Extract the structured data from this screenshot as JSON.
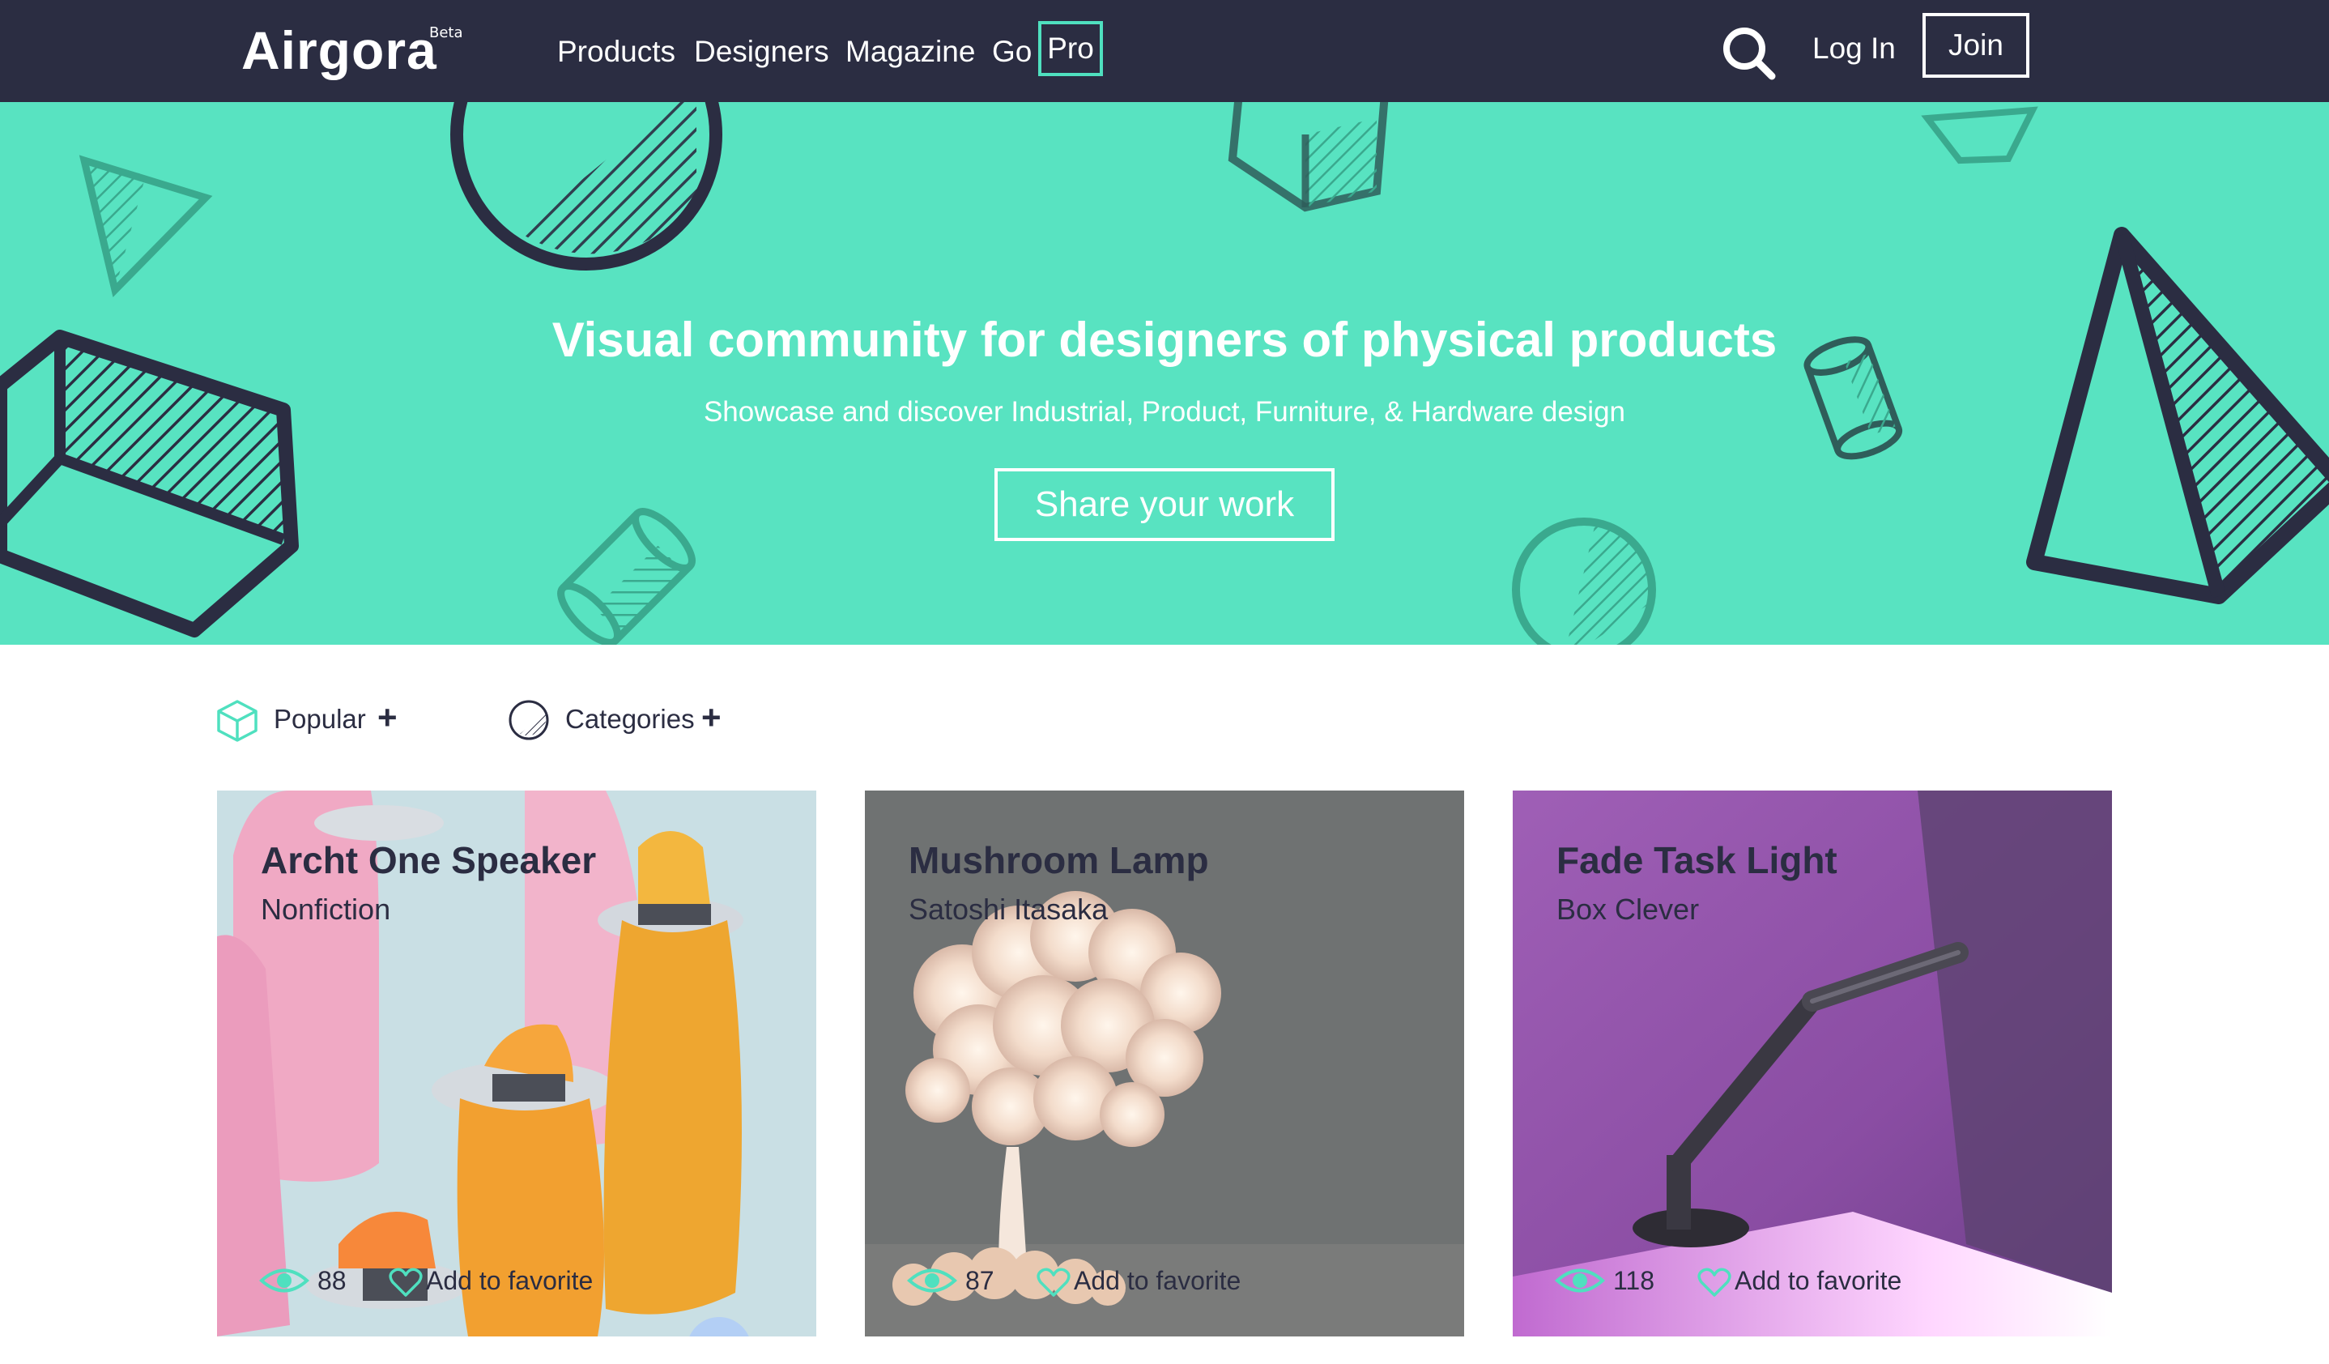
{
  "header": {
    "logo": "Airgora",
    "beta": "Beta",
    "nav": [
      "Products",
      "Designers",
      "Magazine",
      "Go"
    ],
    "pro": "Pro",
    "login": "Log In",
    "join": "Join"
  },
  "hero": {
    "title": "Visual community for designers of physical products",
    "subtitle": "Showcase and discover Industrial, Product, Furniture, & Hardware design",
    "cta": "Share your work"
  },
  "filters": {
    "popular": "Popular",
    "categories": "Categories",
    "plus": "+"
  },
  "cards": [
    {
      "title": "Archt One Speaker",
      "author": "Nonfiction",
      "views": "88",
      "fav": "Add to favorite"
    },
    {
      "title": "Mushroom Lamp",
      "author": "Satoshi Itasaka",
      "views": "87",
      "fav": "Add to favorite"
    },
    {
      "title": "Fade Task Light",
      "author": "Box Clever",
      "views": "118",
      "fav": "Add to favorite"
    }
  ],
  "colors": {
    "nav_bg": "#2b2d42",
    "hero_bg": "#58e3c1",
    "accent": "#4fe0bf",
    "text_dark": "#2b2d42"
  },
  "icons": [
    "search-icon",
    "cube-icon",
    "category-circle-icon",
    "eye-icon",
    "heart-icon"
  ]
}
